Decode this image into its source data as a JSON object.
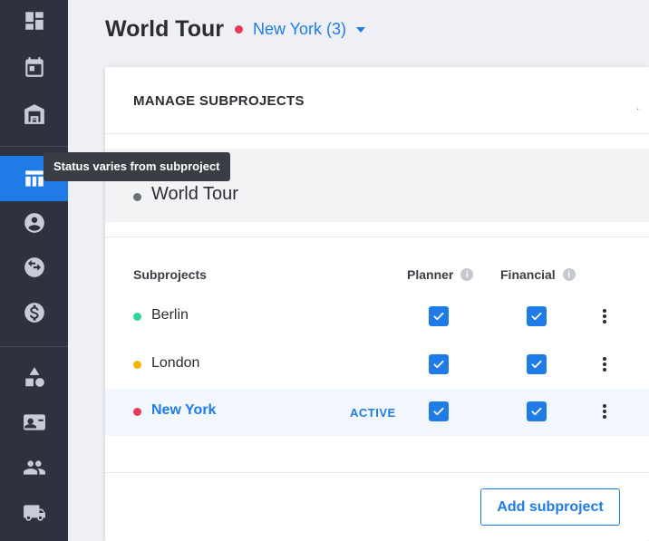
{
  "sidebar": {
    "items": [
      {
        "icon": "dashboard-icon"
      },
      {
        "icon": "calendar-icon"
      },
      {
        "icon": "warehouse-icon"
      },
      {
        "icon": "table-icon",
        "active": true
      },
      {
        "icon": "account-icon"
      },
      {
        "icon": "swap-icon"
      },
      {
        "icon": "dollar-icon"
      },
      {
        "icon": "shapes-icon"
      },
      {
        "icon": "contacts-icon"
      },
      {
        "icon": "people-icon"
      },
      {
        "icon": "truck-icon"
      }
    ],
    "tooltip": "Status varies from subproject"
  },
  "header": {
    "title": "World Tour",
    "dot_color": "#e8385b",
    "selector_label": "New York (3)"
  },
  "modal": {
    "title": "MANAGE SUBPROJECTS",
    "close_glyph": ".",
    "parent": {
      "name": "World Tour",
      "dot_color": "#6c6f77"
    },
    "columns": {
      "subprojects": "Subprojects",
      "planner": "Planner",
      "financial": "Financial",
      "info_glyph": "i"
    },
    "rows": [
      {
        "name": "Berlin",
        "dot_color": "#2fd69a",
        "badge": "",
        "planner": true,
        "financial": true
      },
      {
        "name": "London",
        "dot_color": "#f4b400",
        "badge": "",
        "planner": true,
        "financial": true
      },
      {
        "name": "New York",
        "dot_color": "#e8385b",
        "badge": "ACTIVE",
        "planner": true,
        "financial": true,
        "active": true
      }
    ],
    "add_button": "Add subproject"
  },
  "colors": {
    "accent": "#1f7ce6",
    "sidebar": "#2e323f"
  }
}
